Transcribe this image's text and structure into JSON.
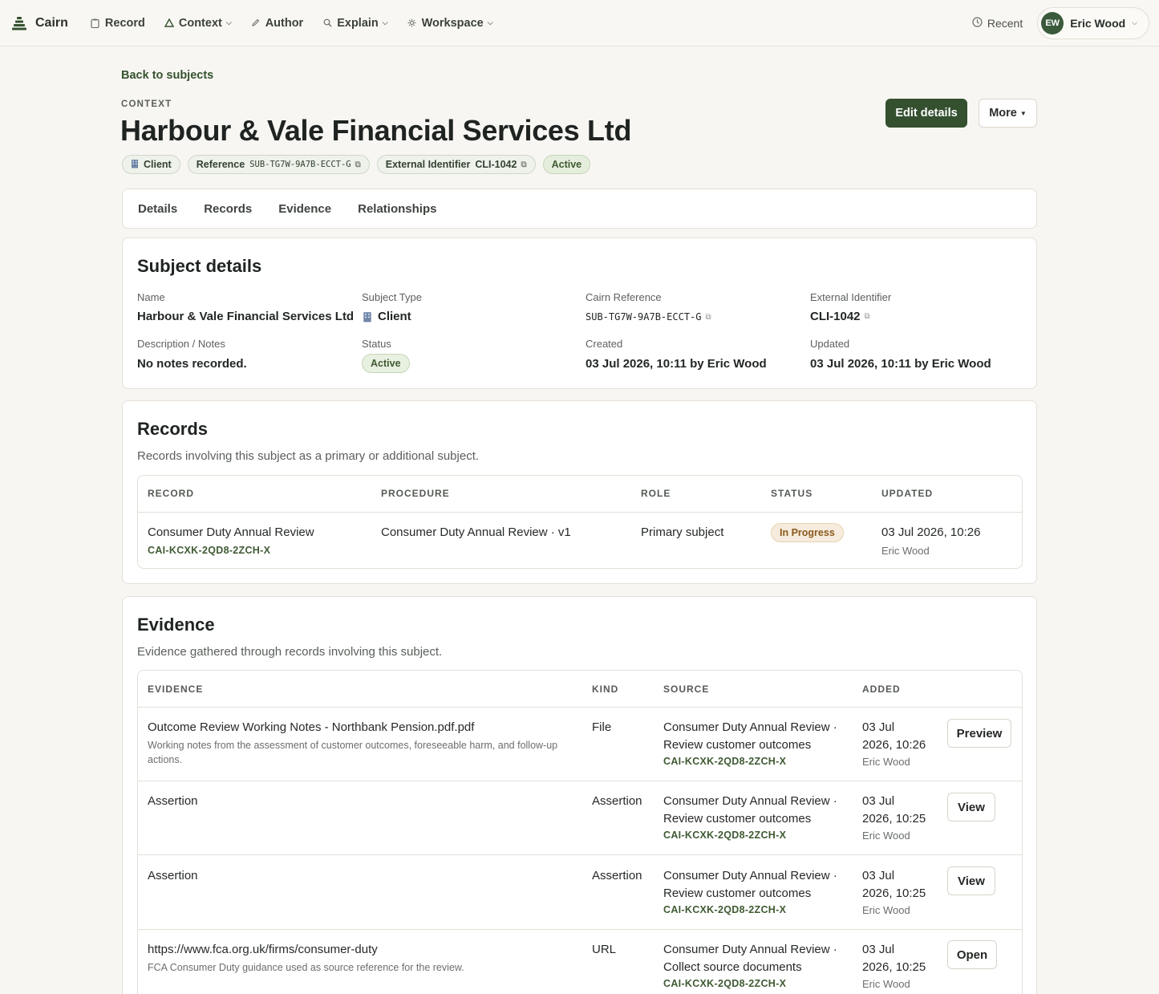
{
  "nav": {
    "brand": "Cairn",
    "items": [
      {
        "label": "Record",
        "icon": "clipboard-icon",
        "dropdown": false
      },
      {
        "label": "Context",
        "icon": "triangle-icon",
        "dropdown": true
      },
      {
        "label": "Author",
        "icon": "pencil-icon",
        "dropdown": false
      },
      {
        "label": "Explain",
        "icon": "search-icon",
        "dropdown": true
      },
      {
        "label": "Workspace",
        "icon": "gear-icon",
        "dropdown": true
      }
    ],
    "recent": "Recent",
    "user": {
      "initials": "EW",
      "name": "Eric Wood"
    }
  },
  "header": {
    "back": "Back to subjects",
    "eyebrow": "CONTEXT",
    "title": "Harbour & Vale Financial Services Ltd",
    "edit": "Edit details",
    "more": "More",
    "chips": {
      "type": "Client",
      "reference_label": "Reference",
      "reference_value": "SUB-TG7W-9A7B-ECCT-G",
      "external_label": "External Identifier",
      "external_value": "CLI-1042",
      "status": "Active"
    }
  },
  "tabs": [
    "Details",
    "Records",
    "Evidence",
    "Relationships"
  ],
  "details": {
    "heading": "Subject details",
    "name_label": "Name",
    "name_value": "Harbour & Vale Financial Services Ltd",
    "type_label": "Subject Type",
    "type_value": "Client",
    "ref_label": "Cairn Reference",
    "ref_value": "SUB-TG7W-9A7B-ECCT-G",
    "ext_label": "External Identifier",
    "ext_value": "CLI-1042",
    "notes_label": "Description / Notes",
    "notes_value": "No notes recorded.",
    "status_label": "Status",
    "status_value": "Active",
    "created_label": "Created",
    "created_value": "03 Jul 2026, 10:11 by Eric Wood",
    "updated_label": "Updated",
    "updated_value": "03 Jul 2026, 10:11 by Eric Wood"
  },
  "records": {
    "heading": "Records",
    "sub": "Records involving this subject as a primary or additional subject.",
    "columns": [
      "RECORD",
      "PROCEDURE",
      "ROLE",
      "STATUS",
      "UPDATED"
    ],
    "rows": [
      {
        "record": "Consumer Duty Annual Review",
        "code": "CAI-KCXK-2QD8-2ZCH-X",
        "procedure": "Consumer Duty Annual Review · v1",
        "role": "Primary subject",
        "status": "In Progress",
        "updated": "03 Jul 2026, 10:26",
        "by": "Eric Wood"
      }
    ]
  },
  "evidence": {
    "heading": "Evidence",
    "sub": "Evidence gathered through records involving this subject.",
    "columns": [
      "EVIDENCE",
      "KIND",
      "SOURCE",
      "ADDED"
    ],
    "rows": [
      {
        "title": "Outcome Review Working Notes - Northbank Pension.pdf.pdf",
        "desc_line1": "Working notes from the assessment of customer outcomes, foreseeable harm, and follow-up",
        "desc_line2": "actions.",
        "kind": "File",
        "src1": "Consumer Duty Annual Review ·",
        "src2": "Review customer outcomes",
        "code": "CAI-KCXK-2QD8-2ZCH-X",
        "added1": "03 Jul",
        "added2": "2026, 10:26",
        "by": "Eric Wood",
        "action": "Preview"
      },
      {
        "title": "Assertion",
        "kind": "Assertion",
        "src1": "Consumer Duty Annual Review ·",
        "src2": "Review customer outcomes",
        "code": "CAI-KCXK-2QD8-2ZCH-X",
        "added1": "03 Jul",
        "added2": "2026, 10:25",
        "by": "Eric Wood",
        "action": "View"
      },
      {
        "title": "Assertion",
        "kind": "Assertion",
        "src1": "Consumer Duty Annual Review ·",
        "src2": "Review customer outcomes",
        "code": "CAI-KCXK-2QD8-2ZCH-X",
        "added1": "03 Jul",
        "added2": "2026, 10:25",
        "by": "Eric Wood",
        "action": "View"
      },
      {
        "title": "https://www.fca.org.uk/firms/consumer-duty",
        "desc_line1": "FCA Consumer Duty guidance used as source reference for the review.",
        "kind": "URL",
        "src1": "Consumer Duty Annual Review ·",
        "src2": "Collect source documents",
        "code": "CAI-KCXK-2QD8-2ZCH-X",
        "added1": "03 Jul",
        "added2": "2026, 10:25",
        "by": "Eric Wood",
        "action": "Open"
      }
    ]
  },
  "colors": {
    "accent": "#34502f",
    "background": "#f8f6f2",
    "active_badge": "#e8f0e0",
    "progress_badge": "#f6ebdc"
  }
}
